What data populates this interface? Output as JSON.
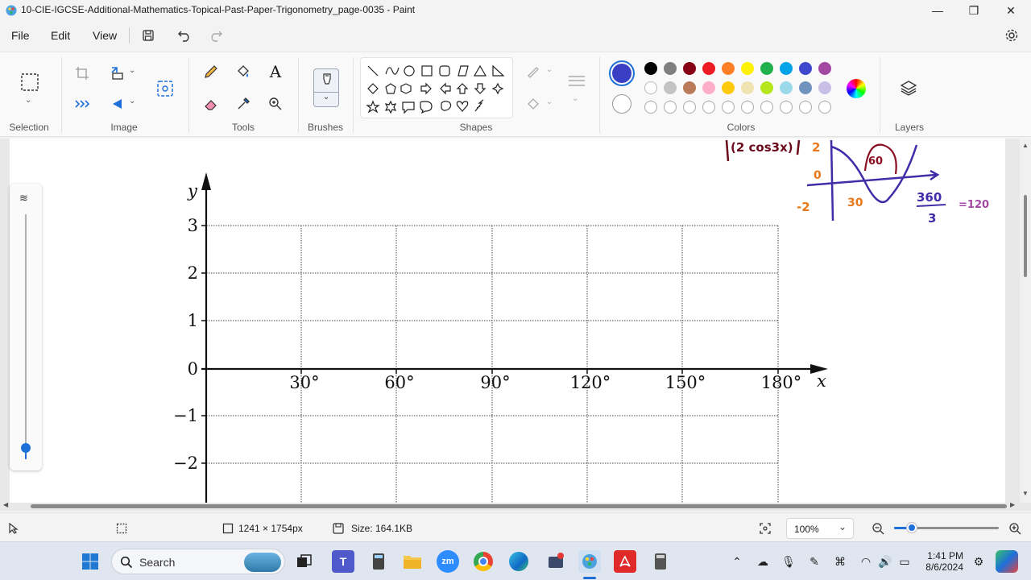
{
  "window": {
    "title": "10-CIE-IGCSE-Additional-Mathematics-Topical-Past-Paper-Trigonometry_page-0035 - Paint",
    "minimize": "—",
    "maximize": "❐",
    "close": "✕"
  },
  "menu": {
    "file": "File",
    "edit": "Edit",
    "view": "View"
  },
  "ribbon": {
    "groups": {
      "selection": "Selection",
      "image": "Image",
      "tools": "Tools",
      "brushes": "Brushes",
      "shapes": "Shapes",
      "colors": "Colors",
      "layers": "Layers"
    },
    "colors": {
      "primary": "#3a3fc4",
      "row1": [
        "#000000",
        "#7f7f7f",
        "#880015",
        "#ed1c24",
        "#ff7f27",
        "#fff200",
        "#22b14c",
        "#00a2e8",
        "#3f48cc",
        "#a349a4"
      ],
      "row2": [
        "#ffffff",
        "#c3c3c3",
        "#b97a57",
        "#ffaec9",
        "#ffc90e",
        "#efe4b0",
        "#b5e61d",
        "#99d9ea",
        "#7092be",
        "#c8bfe7"
      ]
    }
  },
  "graph": {
    "y_label": "y",
    "x_label": "x",
    "y_ticks": [
      "3",
      "2",
      "1",
      "0",
      "−1",
      "−2"
    ],
    "x_ticks": [
      "30°",
      "60°",
      "90°",
      "120°",
      "150°",
      "180°"
    ]
  },
  "annotation": {
    "header_text": "(2 cos3x)",
    "amp_pos": "2",
    "zero": "0",
    "amp_neg": "-2",
    "peak": "60",
    "root": "30",
    "period_num": "360",
    "period_den": "3",
    "period_result": "=120"
  },
  "status": {
    "dimensions": "1241 × 1754px",
    "size": "Size: 164.1KB",
    "zoom": "100%"
  },
  "taskbar": {
    "search_placeholder": "Search",
    "time": "1:41 PM",
    "date": "8/6/2024"
  }
}
